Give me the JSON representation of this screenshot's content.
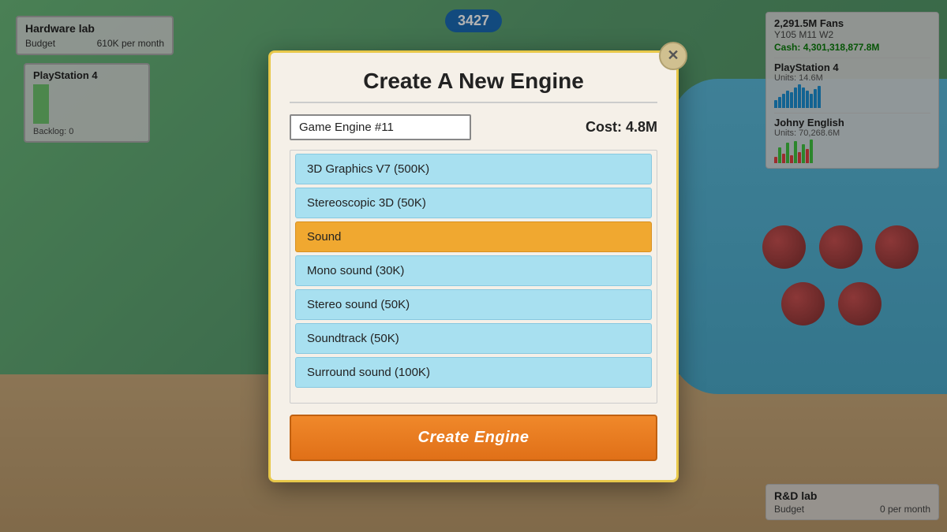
{
  "game": {
    "score": "3427",
    "fans": "2,291.5M Fans",
    "year_month": "Y105 M11 W2",
    "cash_label": "Cash:",
    "cash_value": "4,301,318,877.8M"
  },
  "hardware_lab": {
    "title": "Hardware lab",
    "budget_label": "Budget",
    "budget_value": "610K per month",
    "ps4_label": "PlayStation 4",
    "backlog": "Backlog: 0"
  },
  "right_stats": {
    "ps4_title": "PlayStation 4",
    "ps4_units": "Units: 14.6M",
    "johny_title": "Johny English",
    "johny_units": "Units: 70,268.6M"
  },
  "rd_lab": {
    "title": "R&D lab",
    "budget_label": "Budget",
    "budget_value": "0 per month"
  },
  "modal": {
    "title": "Create A New Engine",
    "close_label": "✕",
    "engine_name": "Game Engine #11",
    "cost_label": "Cost: 4.8M",
    "features": [
      {
        "type": "item",
        "label": "3D Graphics V7 (500K)"
      },
      {
        "type": "item",
        "label": "Stereoscopic 3D (50K)"
      },
      {
        "type": "category",
        "label": "Sound"
      },
      {
        "type": "item",
        "label": "Mono sound (30K)"
      },
      {
        "type": "item",
        "label": "Stereo sound (50K)"
      },
      {
        "type": "item",
        "label": "Soundtrack (50K)"
      },
      {
        "type": "item",
        "label": "Surround sound (100K)"
      }
    ],
    "create_button": "Create Engine"
  }
}
